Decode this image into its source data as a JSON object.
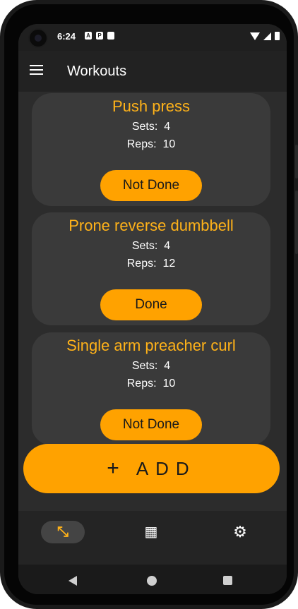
{
  "status_bar": {
    "time": "6:24",
    "notification_icons": [
      "A",
      "P",
      ""
    ],
    "system_icons": [
      "wifi-icon",
      "signal-icon",
      "battery-icon"
    ]
  },
  "app_bar": {
    "title": "Workouts",
    "menu_icon": "menu-icon"
  },
  "workouts": [
    {
      "name": "Push press",
      "sets_label": "Sets:",
      "sets": "4",
      "reps_label": "Reps:",
      "reps": "10",
      "status": "Not Done"
    },
    {
      "name": "Prone reverse dumbbell",
      "sets_label": "Sets:",
      "sets": "4",
      "reps_label": "Reps:",
      "reps": "12",
      "status": "Done"
    },
    {
      "name": "Single arm preacher curl",
      "sets_label": "Sets:",
      "sets": "4",
      "reps_label": "Reps:",
      "reps": "10",
      "status": "Not Done"
    }
  ],
  "add_button": {
    "icon": "+",
    "label": "ADD"
  },
  "bottom_nav": [
    {
      "name": "workouts",
      "icon": "dumbbell-icon",
      "glyph": "⤡",
      "active": true
    },
    {
      "name": "calendar",
      "icon": "calendar-icon",
      "glyph": "▦",
      "active": false
    },
    {
      "name": "settings",
      "icon": "gear-icon",
      "glyph": "⚙",
      "active": false
    }
  ],
  "colors": {
    "accent": "#ffa200",
    "title_text": "#ffb219",
    "card_bg": "#3a3a3a",
    "screen_bg": "#2c2c2c"
  }
}
